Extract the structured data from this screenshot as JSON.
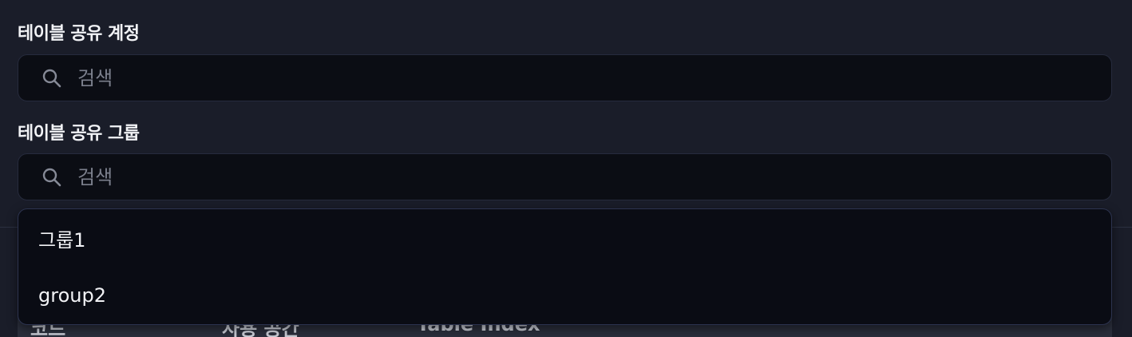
{
  "account_section": {
    "title": "테이블 공유 계정",
    "search_placeholder": "검색",
    "search_value": ""
  },
  "group_section": {
    "title": "테이블 공유 그룹",
    "search_placeholder": "검색",
    "search_value": "",
    "dropdown_options": [
      "그룹1",
      "group2"
    ]
  },
  "background_table": {
    "headers": [
      "코드",
      "사용 공간",
      "Table Index"
    ]
  },
  "icons": {
    "search": "search-icon"
  }
}
